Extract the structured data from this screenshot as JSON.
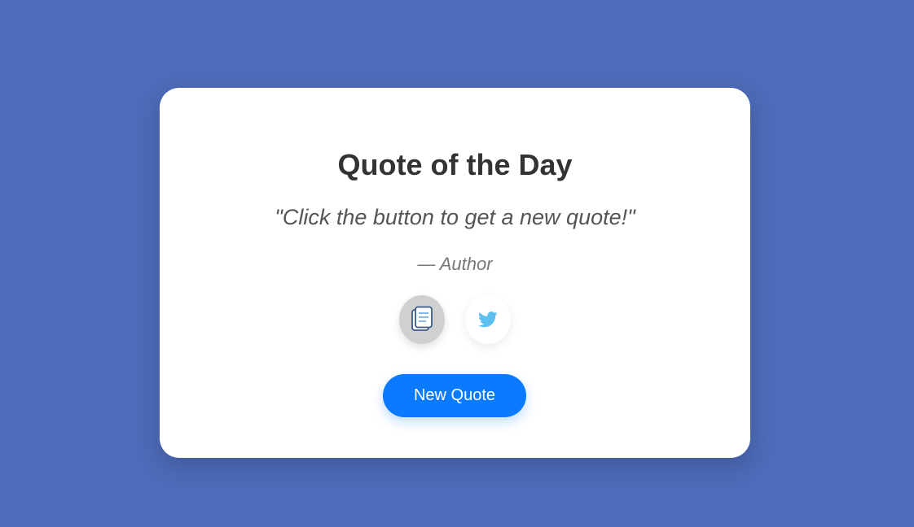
{
  "card": {
    "title": "Quote of the Day",
    "quote": "\"Click the button to get a new quote!\"",
    "author": "— Author"
  },
  "actions": {
    "copy_icon": "copy-icon",
    "tweet_icon": "twitter-icon",
    "new_quote_label": "New Quote"
  },
  "colors": {
    "background": "#4d6bb9",
    "card": "#ffffff",
    "button": "#0a7bff",
    "twitter": "#5bc0f0"
  }
}
